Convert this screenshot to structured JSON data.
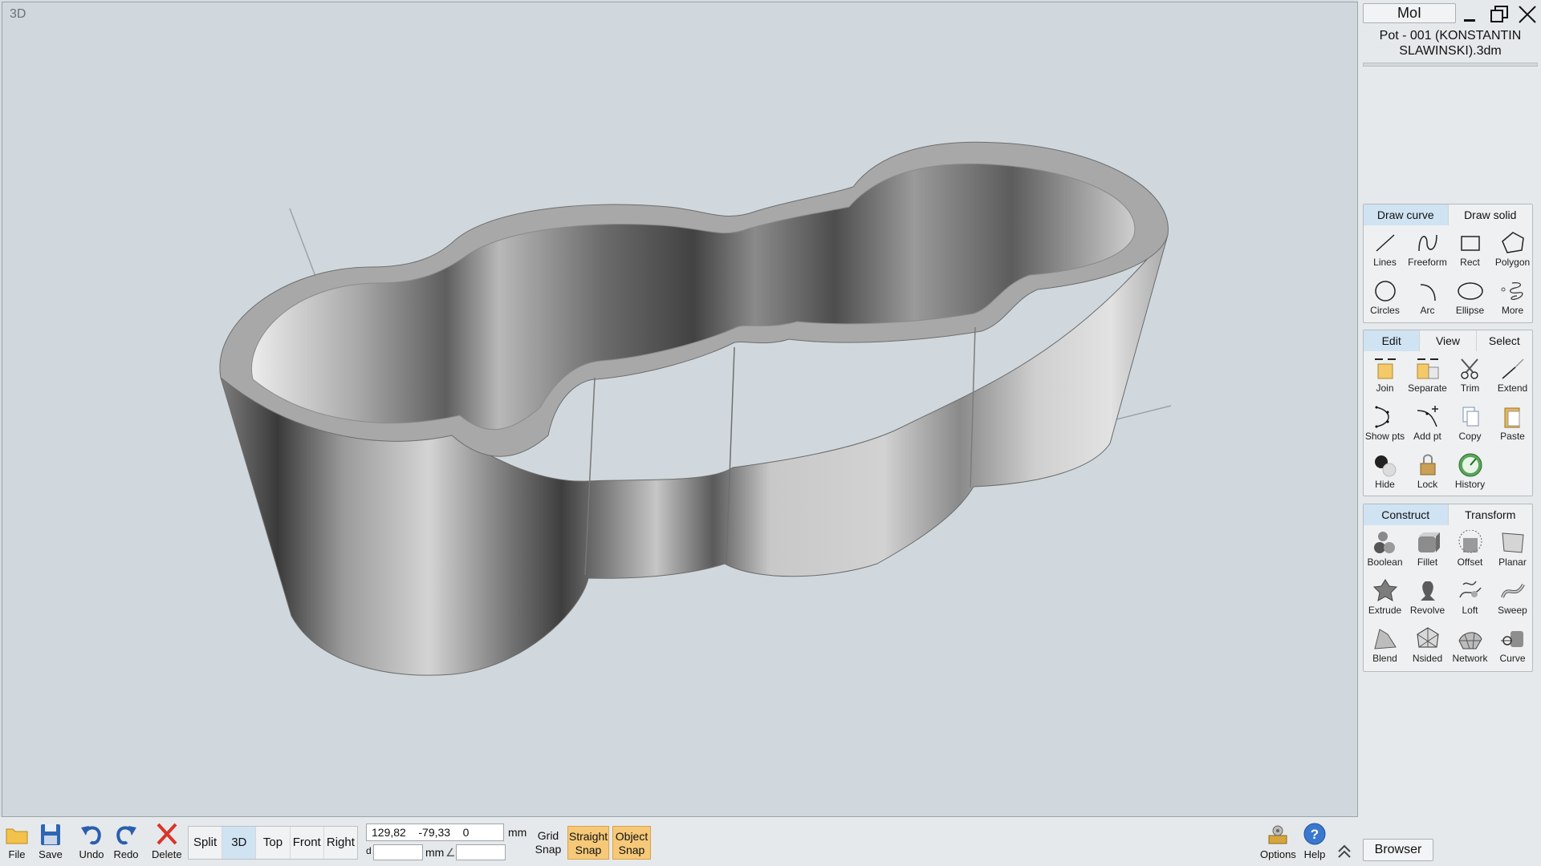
{
  "viewport": {
    "label": "3D"
  },
  "window": {
    "app_title": "MoI",
    "file_name": "Pot - 001 (KONSTANTIN SLAWINSKI).3dm"
  },
  "draw_panel": {
    "tabs": [
      "Draw curve",
      "Draw solid"
    ],
    "active_tab": "Draw curve",
    "tools": [
      {
        "label": "Lines",
        "icon": "line-icon"
      },
      {
        "label": "Freeform",
        "icon": "freeform-icon"
      },
      {
        "label": "Rect",
        "icon": "rectangle-icon"
      },
      {
        "label": "Polygon",
        "icon": "polygon-icon"
      },
      {
        "label": "Circles",
        "icon": "circle-icon"
      },
      {
        "label": "Arc",
        "icon": "arc-icon"
      },
      {
        "label": "Ellipse",
        "icon": "ellipse-icon"
      },
      {
        "label": "More",
        "icon": "spiral-icon"
      }
    ]
  },
  "edit_panel": {
    "tabs": [
      "Edit",
      "View",
      "Select"
    ],
    "active_tab": "Edit",
    "tools": [
      {
        "label": "Join",
        "icon": "join-icon"
      },
      {
        "label": "Separate",
        "icon": "separate-icon"
      },
      {
        "label": "Trim",
        "icon": "scissors-icon"
      },
      {
        "label": "Extend",
        "icon": "extend-icon"
      },
      {
        "label": "Show pts",
        "icon": "show-points-icon"
      },
      {
        "label": "Add pt",
        "icon": "add-point-icon"
      },
      {
        "label": "Copy",
        "icon": "copy-icon"
      },
      {
        "label": "Paste",
        "icon": "paste-icon"
      },
      {
        "label": "Hide",
        "icon": "hide-icon"
      },
      {
        "label": "Lock",
        "icon": "lock-icon"
      },
      {
        "label": "History",
        "icon": "history-icon"
      }
    ]
  },
  "construct_panel": {
    "tabs": [
      "Construct",
      "Transform"
    ],
    "active_tab": "Construct",
    "tools": [
      {
        "label": "Boolean",
        "icon": "boolean-icon"
      },
      {
        "label": "Fillet",
        "icon": "fillet-icon"
      },
      {
        "label": "Offset",
        "icon": "offset-icon"
      },
      {
        "label": "Planar",
        "icon": "planar-icon"
      },
      {
        "label": "Extrude",
        "icon": "extrude-icon"
      },
      {
        "label": "Revolve",
        "icon": "revolve-icon"
      },
      {
        "label": "Loft",
        "icon": "loft-icon"
      },
      {
        "label": "Sweep",
        "icon": "sweep-icon"
      },
      {
        "label": "Blend",
        "icon": "blend-icon"
      },
      {
        "label": "Nsided",
        "icon": "nsided-icon"
      },
      {
        "label": "Network",
        "icon": "network-icon"
      },
      {
        "label": "Curve",
        "icon": "curve-icon"
      }
    ]
  },
  "bottom_bar": {
    "file": "File",
    "save": "Save",
    "undo": "Undo",
    "redo": "Redo",
    "delete": "Delete",
    "views": [
      "Split",
      "3D",
      "Top",
      "Front",
      "Right"
    ],
    "active_view": "3D",
    "coords": "129,82    -79,33    0",
    "unit": "mm",
    "distance_prefix": "d",
    "distance_unit": "mm",
    "angle_symbol": "∠",
    "grid_snap": [
      "Grid",
      "Snap"
    ],
    "straight_snap": [
      "Straight",
      "Snap"
    ],
    "object_snap": [
      "Object",
      "Snap"
    ],
    "options": "Options",
    "help": "Help",
    "browser": "Browser"
  },
  "colors": {
    "active_tab": "#cfe3f3",
    "snap_on": "#f6c979",
    "viewport_bg": "#d0d8dd"
  }
}
